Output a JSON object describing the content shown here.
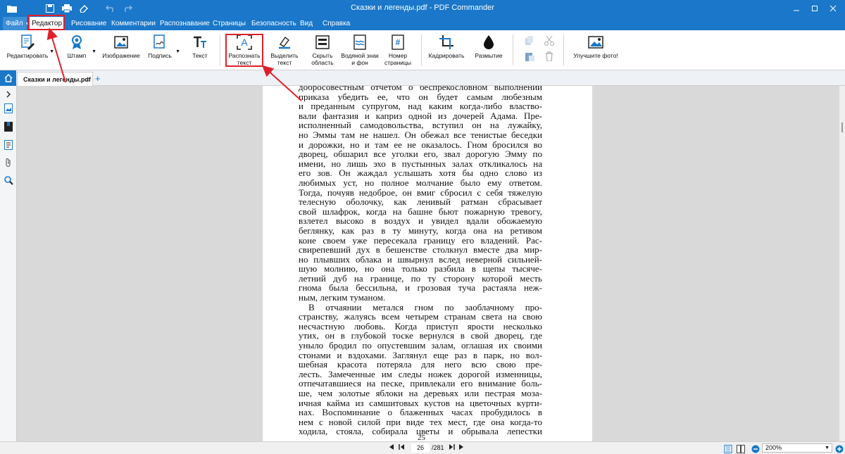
{
  "window": {
    "title": "Сказки и легенды.pdf - PDF Commander"
  },
  "menu": {
    "file": "Файл",
    "tabs": [
      "Редактор",
      "Рисование",
      "Комментарии",
      "Распознавание",
      "Страницы",
      "Безопасность",
      "Вид",
      "Справка"
    ]
  },
  "ribbon": {
    "edit": "Редактировать",
    "stamp": "Штамп",
    "image": "Изображение",
    "signature": "Подпись",
    "text": "Текст",
    "recognize": [
      "Распознать",
      "текст"
    ],
    "select_text": [
      "Выделить",
      "текст"
    ],
    "hide_area": [
      "Скрыть",
      "область"
    ],
    "watermark": [
      "Водяной знак",
      "и фон"
    ],
    "page_number": [
      "Номер",
      "страницы"
    ],
    "crop": "Кадрировать",
    "blur": "Размытие",
    "improve_photo": "Улучшите фото!"
  },
  "tabs": {
    "doc_name": "Сказки и легенды.pdf",
    "close": "×",
    "add": "+"
  },
  "document": {
    "page_number": "25",
    "lines": [
      {
        "t": "добросовестным отчетом о беспрекословном выполнении"
      },
      {
        "t": "приказа убедить ее, что он будет самым любезным"
      },
      {
        "t": "и преданным супругом, над каким когда-либо властво-"
      },
      {
        "t": "вали фантазия и каприз одной из дочерей Адама. Пре-"
      },
      {
        "t": "исполненный самодовольства, вступил он на лужайку,"
      },
      {
        "t": "но Эммы там не нашел. Он обежал все тенистые беседки"
      },
      {
        "t": "и дорожки, но и там ее не оказалось. Гном бросился во"
      },
      {
        "t": "дворец, обшарил все уголки его, звал дорогую Эмму по"
      },
      {
        "t": "имени, но лишь эхо в пустынных залах откликалось на"
      },
      {
        "t": "его зов. Он жаждал услышать хотя бы одно слово из"
      },
      {
        "t": "любимых уст, но полное молчание было ему ответом."
      },
      {
        "t": "Тогда, почуяв недоброе, он вмиг сбросил с себя тяжелую"
      },
      {
        "t": "телесную оболочку, как ленивый ратман сбрасывает"
      },
      {
        "t": "свой шлафрок, когда на башне бьют пожарную тревогу,"
      },
      {
        "t": "взлетел высоко в воздух и увидел вдали обожаемую"
      },
      {
        "t": "беглянку, как раз в ту минуту, когда она на ретивом"
      },
      {
        "t": "коне своем уже пересекала границу его владений. Рас-"
      },
      {
        "t": "свирепевший дух в бешенстве столкнул вместе два мир-"
      },
      {
        "t": "но плывших облака и швырнул вслед неверной сильней-"
      },
      {
        "t": "шую молнию, но она только разбила в щепы тысяче-"
      },
      {
        "t": "летний дуб на границе, по ту сторону которой месть"
      },
      {
        "t": "гнома была бессильна, и грозовая туча растаяла неж-"
      },
      {
        "t": "ным, легким туманом.",
        "last": true
      },
      {
        "t": "В отчаянии метался гном по заоблачному про-",
        "indent": true
      },
      {
        "t": "странству, жалуясь всем четырем странам света на свою"
      },
      {
        "t": "несчастную любовь. Когда приступ ярости несколько"
      },
      {
        "t": "утих, он в глубокой тоске вернулся в свой дворец, где"
      },
      {
        "t": "уныло бродил по опустевшим залам, оглашая их своими"
      },
      {
        "t": "стонами и вздохами. Заглянул еще раз в парк, но вол-"
      },
      {
        "t": "шебная красота потеряла для него всю свою пре-"
      },
      {
        "t": "лесть. Замеченные им следы ножек дорогой изменницы,"
      },
      {
        "t": "отпечатавшиеся на песке, привлекали его внимание боль-"
      },
      {
        "t": "ше, чем золотые яблоки на деревьях или пестрая моза-"
      },
      {
        "t": "ичная кайма из самшитовых кустов на цветочных курти-"
      },
      {
        "t": "нах. Воспоминание о блаженных часах пробудилось в"
      },
      {
        "t": "нем с новой силой при виде тех мест, где она когда-то"
      },
      {
        "t": "ходила, стояла, собирала цветы и обрывала лепестки"
      }
    ]
  },
  "status": {
    "current_page": "26",
    "total_pages": "/281",
    "zoom": "200%"
  },
  "colors": {
    "brand": "#1a77c9",
    "highlight": "#e0202a"
  }
}
